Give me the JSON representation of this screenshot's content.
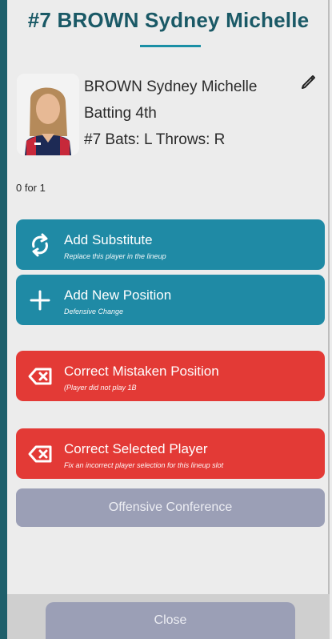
{
  "header": {
    "title": "#7 BROWN Sydney Michelle"
  },
  "player": {
    "name": "BROWN Sydney Michelle",
    "batting": "Batting 4th",
    "details": "#7 Bats: L Throws: R"
  },
  "stats": {
    "line": "0 for 1"
  },
  "actions": {
    "add_substitute": {
      "label": "Add Substitute",
      "sub": "Replace this player in the lineup"
    },
    "add_position": {
      "label": "Add New Position",
      "sub": "Defensive Change"
    },
    "correct_position": {
      "label": "Correct Mistaken Position",
      "sub": "(Player did not play 1B"
    },
    "correct_player": {
      "label": "Correct Selected Player",
      "sub": "Fix an incorrect player selection for this lineup slot"
    },
    "offensive_conference": {
      "label": "Offensive Conference"
    }
  },
  "footer": {
    "close_label": "Close"
  },
  "colors": {
    "teal": "#1f8aa5",
    "red": "#e33a36",
    "gray": "#9b9fb6",
    "title": "#1a5966"
  },
  "icons": [
    "edit-pencil-icon",
    "refresh-swap-icon",
    "plus-icon",
    "delete-x-icon",
    "delete-x-icon"
  ]
}
